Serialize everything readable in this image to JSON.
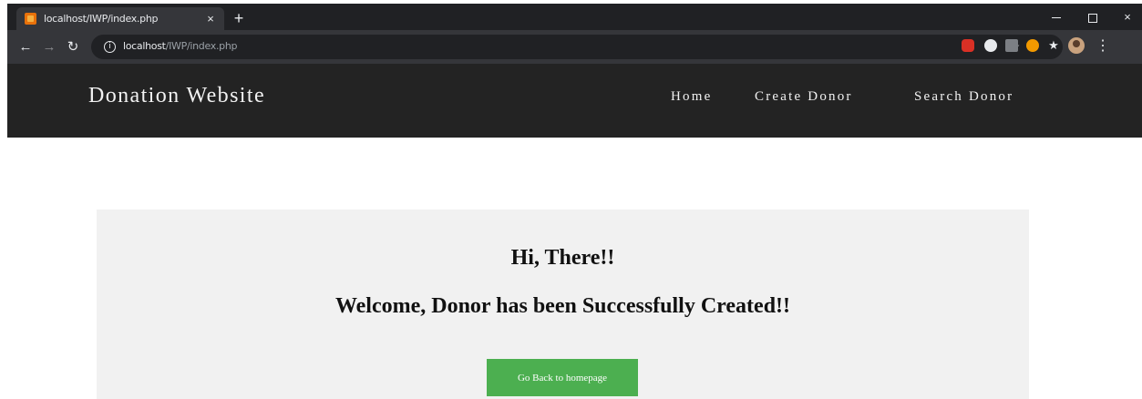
{
  "browser": {
    "tab_title": "localhost/IWP/index.php",
    "tab_close": "×",
    "new_tab": "+",
    "url_host": "localhost",
    "url_path": "/IWP/index.php",
    "window_close": "×",
    "icons": {
      "favicon": "page-favicon",
      "back": "arrow-left",
      "forward": "arrow-right",
      "reload": "reload",
      "info": "info-circle",
      "bookmark": "star-outline",
      "menu": "kebab-vertical"
    }
  },
  "site": {
    "brand": "Donation Website",
    "nav": {
      "home": "Home",
      "create_donor": "Create Donor",
      "search_donor": "Search Donor"
    }
  },
  "main": {
    "greeting": "Hi, There!!",
    "message": "Welcome, Donor has been Successfully Created!!",
    "home_button": "Go Back to homepage"
  },
  "colors": {
    "site_header": "#232323",
    "panel": "#f1f1f1",
    "button": "#4caf50"
  }
}
